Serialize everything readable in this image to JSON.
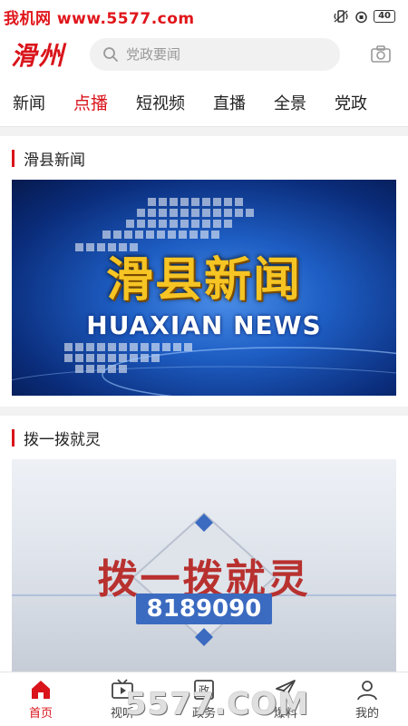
{
  "status_bar": {
    "watermark": "我机网 www.5577.com",
    "battery": "40"
  },
  "header": {
    "logo": "滑州",
    "search": {
      "placeholder": "党政要闻"
    }
  },
  "tabs": [
    {
      "label": "新闻",
      "active": false
    },
    {
      "label": "点播",
      "active": true
    },
    {
      "label": "短视频",
      "active": false
    },
    {
      "label": "直播",
      "active": false
    },
    {
      "label": "全景",
      "active": false
    },
    {
      "label": "党政",
      "active": false
    }
  ],
  "sections": [
    {
      "title": "滑县新闻",
      "thumb_title": "滑县新闻",
      "thumb_subtitle": "HUAXIAN NEWS"
    },
    {
      "title": "拨一拨就灵",
      "thumb_title": "拨一拨就灵",
      "thumb_number": "8189090"
    }
  ],
  "bottom_nav": [
    {
      "label": "首页",
      "icon": "home-icon",
      "active": true
    },
    {
      "label": "视听",
      "icon": "tv-icon",
      "active": false
    },
    {
      "label": "政务",
      "icon": "government-icon",
      "active": false
    },
    {
      "label": "爆料",
      "icon": "send-icon",
      "active": false
    },
    {
      "label": "我的",
      "icon": "user-icon",
      "active": false
    }
  ],
  "bottom_watermark": "5577.COM",
  "colors": {
    "accent": "#d9141b",
    "news_blue": "#1e5ec4",
    "gold": "#f6c524"
  }
}
